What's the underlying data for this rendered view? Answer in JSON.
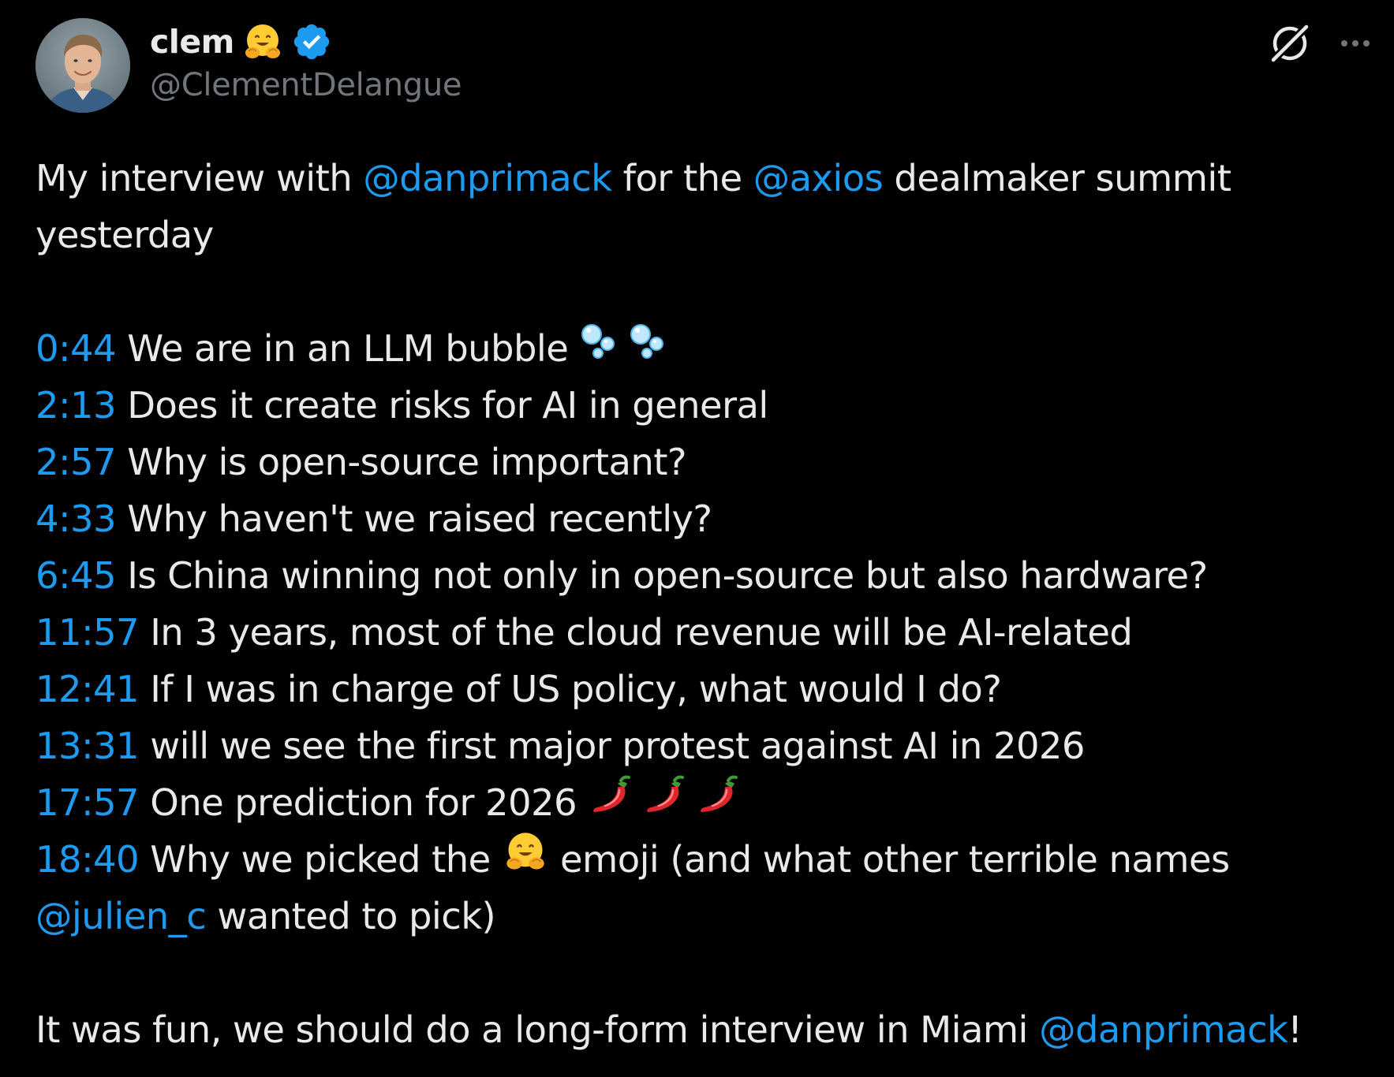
{
  "author": {
    "display_name": "clem",
    "handle": "@ClementDelangue",
    "name_emoji": "hugging-face-emoji",
    "verified": true
  },
  "icons": {
    "grok": "grok-icon",
    "more": "more-icon",
    "verified": "verified-badge-icon"
  },
  "colors": {
    "background": "#000000",
    "text": "#e7e9ea",
    "secondary": "#71767b",
    "link": "#1d9bf0"
  },
  "tweet": {
    "intro_part1": "My interview with ",
    "mention_1": "@danprimack",
    "intro_part2": " for the ",
    "mention_2": "@axios",
    "intro_part3": " dealmaker summit",
    "intro_line2": "yesterday",
    "chapters": [
      {
        "time": "0:44",
        "text": " We are in an LLM bubble ",
        "emoji": "bubbles-emoji"
      },
      {
        "time": "2:13",
        "text": " Does it create risks for AI in general"
      },
      {
        "time": "2:57",
        "text": " Why is open-source important?"
      },
      {
        "time": "4:33",
        "text": " Why haven't we raised recently?"
      },
      {
        "time": "6:45",
        "text": " Is China winning not only in open-source but also hardware?"
      },
      {
        "time": "11:57",
        "text": " In 3 years, most of the cloud revenue will be AI-related"
      },
      {
        "time": "12:41",
        "text": " If I was in charge of US policy, what would I do?"
      },
      {
        "time": "13:31",
        "text": " will we see the first major protest against AI in 2026"
      },
      {
        "time": "17:57",
        "text": " One prediction for 2026 ",
        "emoji": "hot-pepper-emoji"
      },
      {
        "time": "18:40",
        "text_before": " Why we picked the ",
        "emoji": "hugging-face-emoji",
        "text_after": " emoji (and what other terrible names"
      }
    ],
    "chapter_continuation_mention": "@julien_c",
    "chapter_continuation_text": " wanted to pick)",
    "outro_text": "It was fun, we should do a long-form interview in Miami ",
    "outro_mention": "@danprimack",
    "outro_end": "!"
  }
}
